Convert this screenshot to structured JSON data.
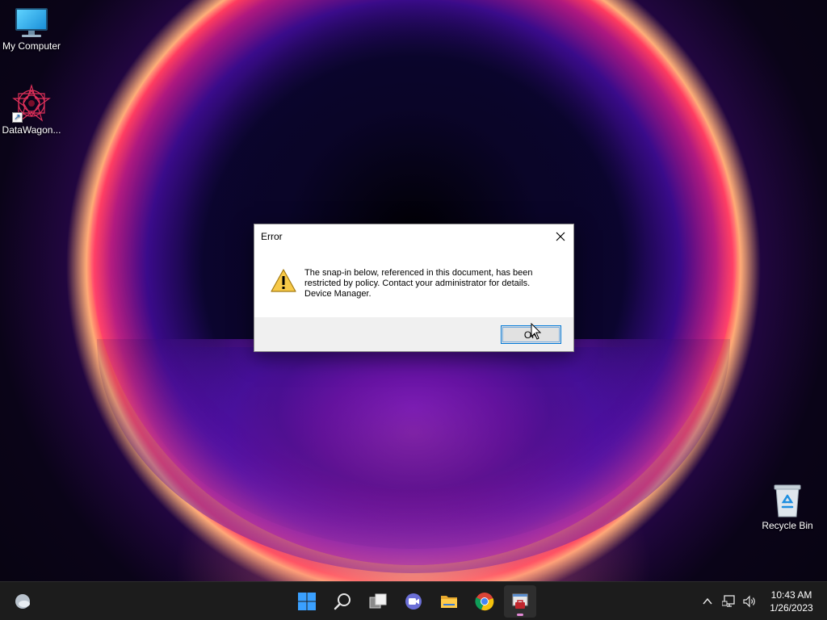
{
  "desktop": {
    "icons": [
      {
        "label": "My Computer",
        "icon": "computer-icon"
      },
      {
        "label": "DataWagon...",
        "icon": "datawagon-shortcut-icon"
      },
      {
        "label": "Recycle Bin",
        "icon": "recycle-bin-icon"
      }
    ]
  },
  "dialog": {
    "title": "Error",
    "message_line1": "The snap-in below, referenced in this document, has been",
    "message_line2": "restricted by policy. Contact your administrator for details.",
    "message_line3": "Device Manager.",
    "ok_label": "OK",
    "icon": "warning-icon"
  },
  "taskbar": {
    "left_icon": "weather-icon",
    "apps": [
      "start-icon",
      "search-icon",
      "task-view-icon",
      "chat-icon",
      "file-explorer-icon",
      "chrome-icon",
      "mmc-icon"
    ],
    "tray": [
      "show-hidden-icons-chevron",
      "network-icon",
      "volume-icon"
    ],
    "time": "10:43 AM",
    "date": "1/26/2023"
  },
  "colors": {
    "accent": "#0078d7",
    "taskbar_bg": "#1c1c1c",
    "dialog_footer": "#f0f0f0"
  }
}
